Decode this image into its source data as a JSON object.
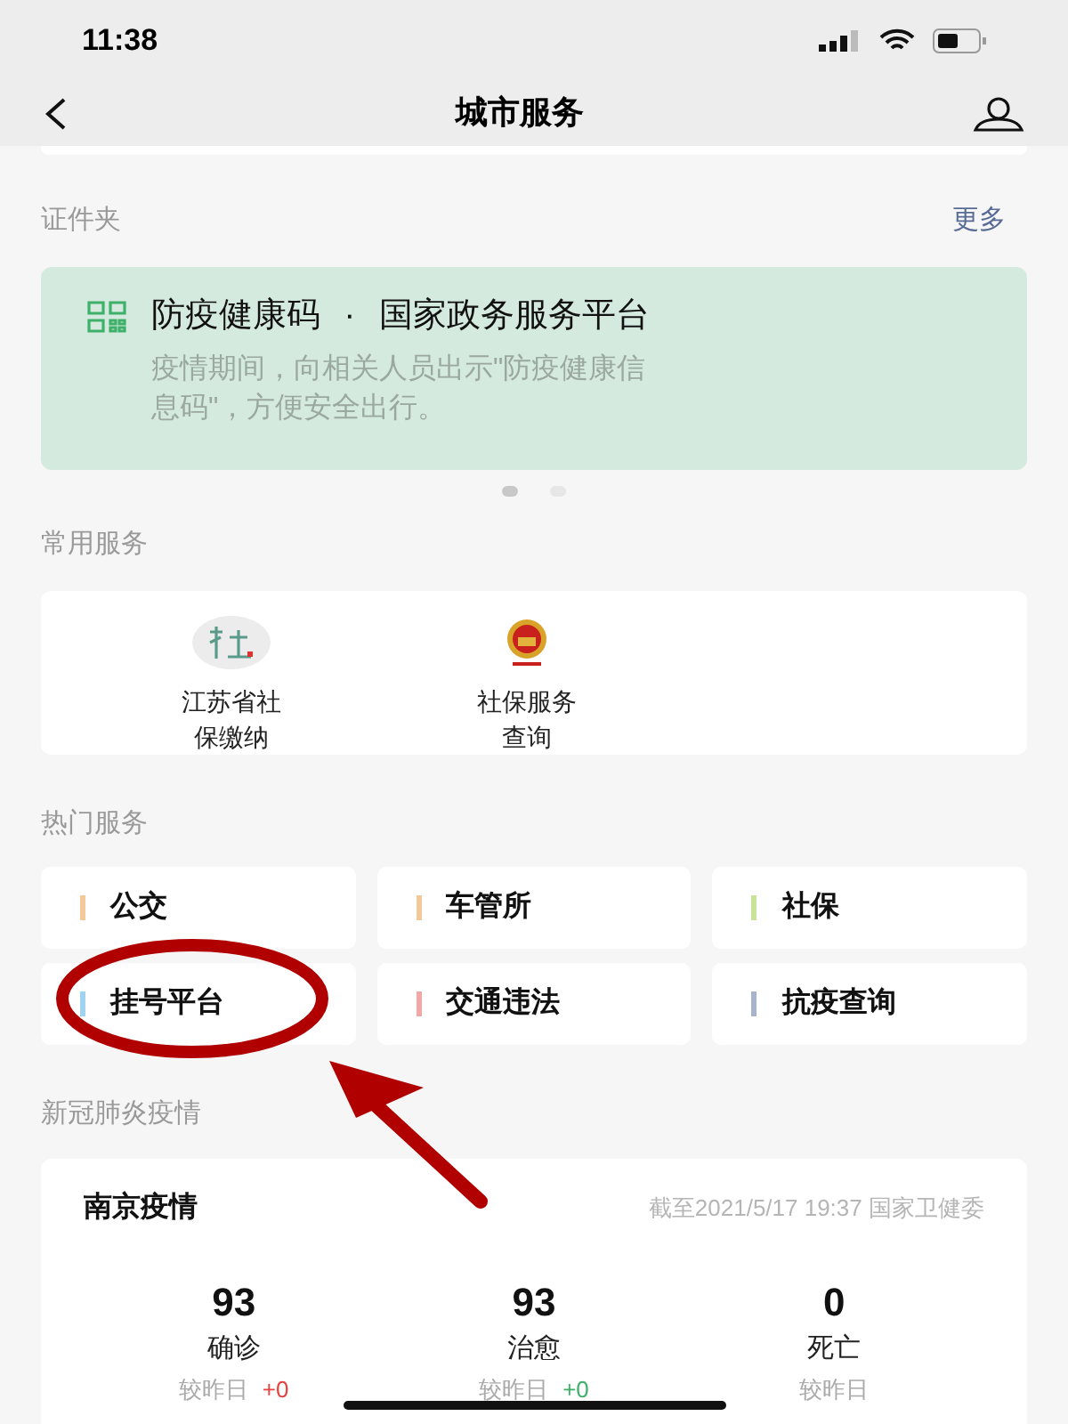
{
  "status_bar": {
    "time": "11:38"
  },
  "nav": {
    "title": "城市服务"
  },
  "documents": {
    "title": "证件夹",
    "more": "更多",
    "card": {
      "title": "防疫健康码",
      "separator": "·",
      "source": "国家政务服务平台",
      "text": "疫情期间，向相关人员出示\"防疫健康信息码\"，方便安全出行。"
    },
    "dots": [
      {
        "selected": true
      },
      {
        "selected": false
      }
    ]
  },
  "common": {
    "title": "常用服务",
    "items": [
      {
        "kind": "social",
        "label": "江苏省社保缴纳"
      },
      {
        "kind": "emblem",
        "label": "社保服务查询"
      }
    ]
  },
  "hot": {
    "title": "热门服务",
    "items": [
      {
        "label": "公交",
        "color": "#f3c99b"
      },
      {
        "label": "车管所",
        "color": "#f3c99b"
      },
      {
        "label": "社保",
        "color": "#c8e39a"
      },
      {
        "label": "挂号平台",
        "color": "#9fd3f0"
      },
      {
        "label": "交通违法",
        "color": "#f0a8a8"
      },
      {
        "label": "抗疫查询",
        "color": "#a8b4cc"
      }
    ]
  },
  "covid": {
    "title": "新冠肺炎疫情",
    "card": {
      "city": "南京疫情",
      "updated": "截至2021/5/17 19:37 国家卫健委",
      "stats": [
        {
          "value": "93",
          "label": "确诊",
          "compare": "较昨日",
          "delta": "+0",
          "color": "#e64340"
        },
        {
          "value": "93",
          "label": "治愈",
          "compare": "较昨日",
          "delta": "+0",
          "color": "#3fb06a"
        },
        {
          "value": "0",
          "label": "死亡",
          "compare": "较昨日"
        }
      ]
    }
  }
}
